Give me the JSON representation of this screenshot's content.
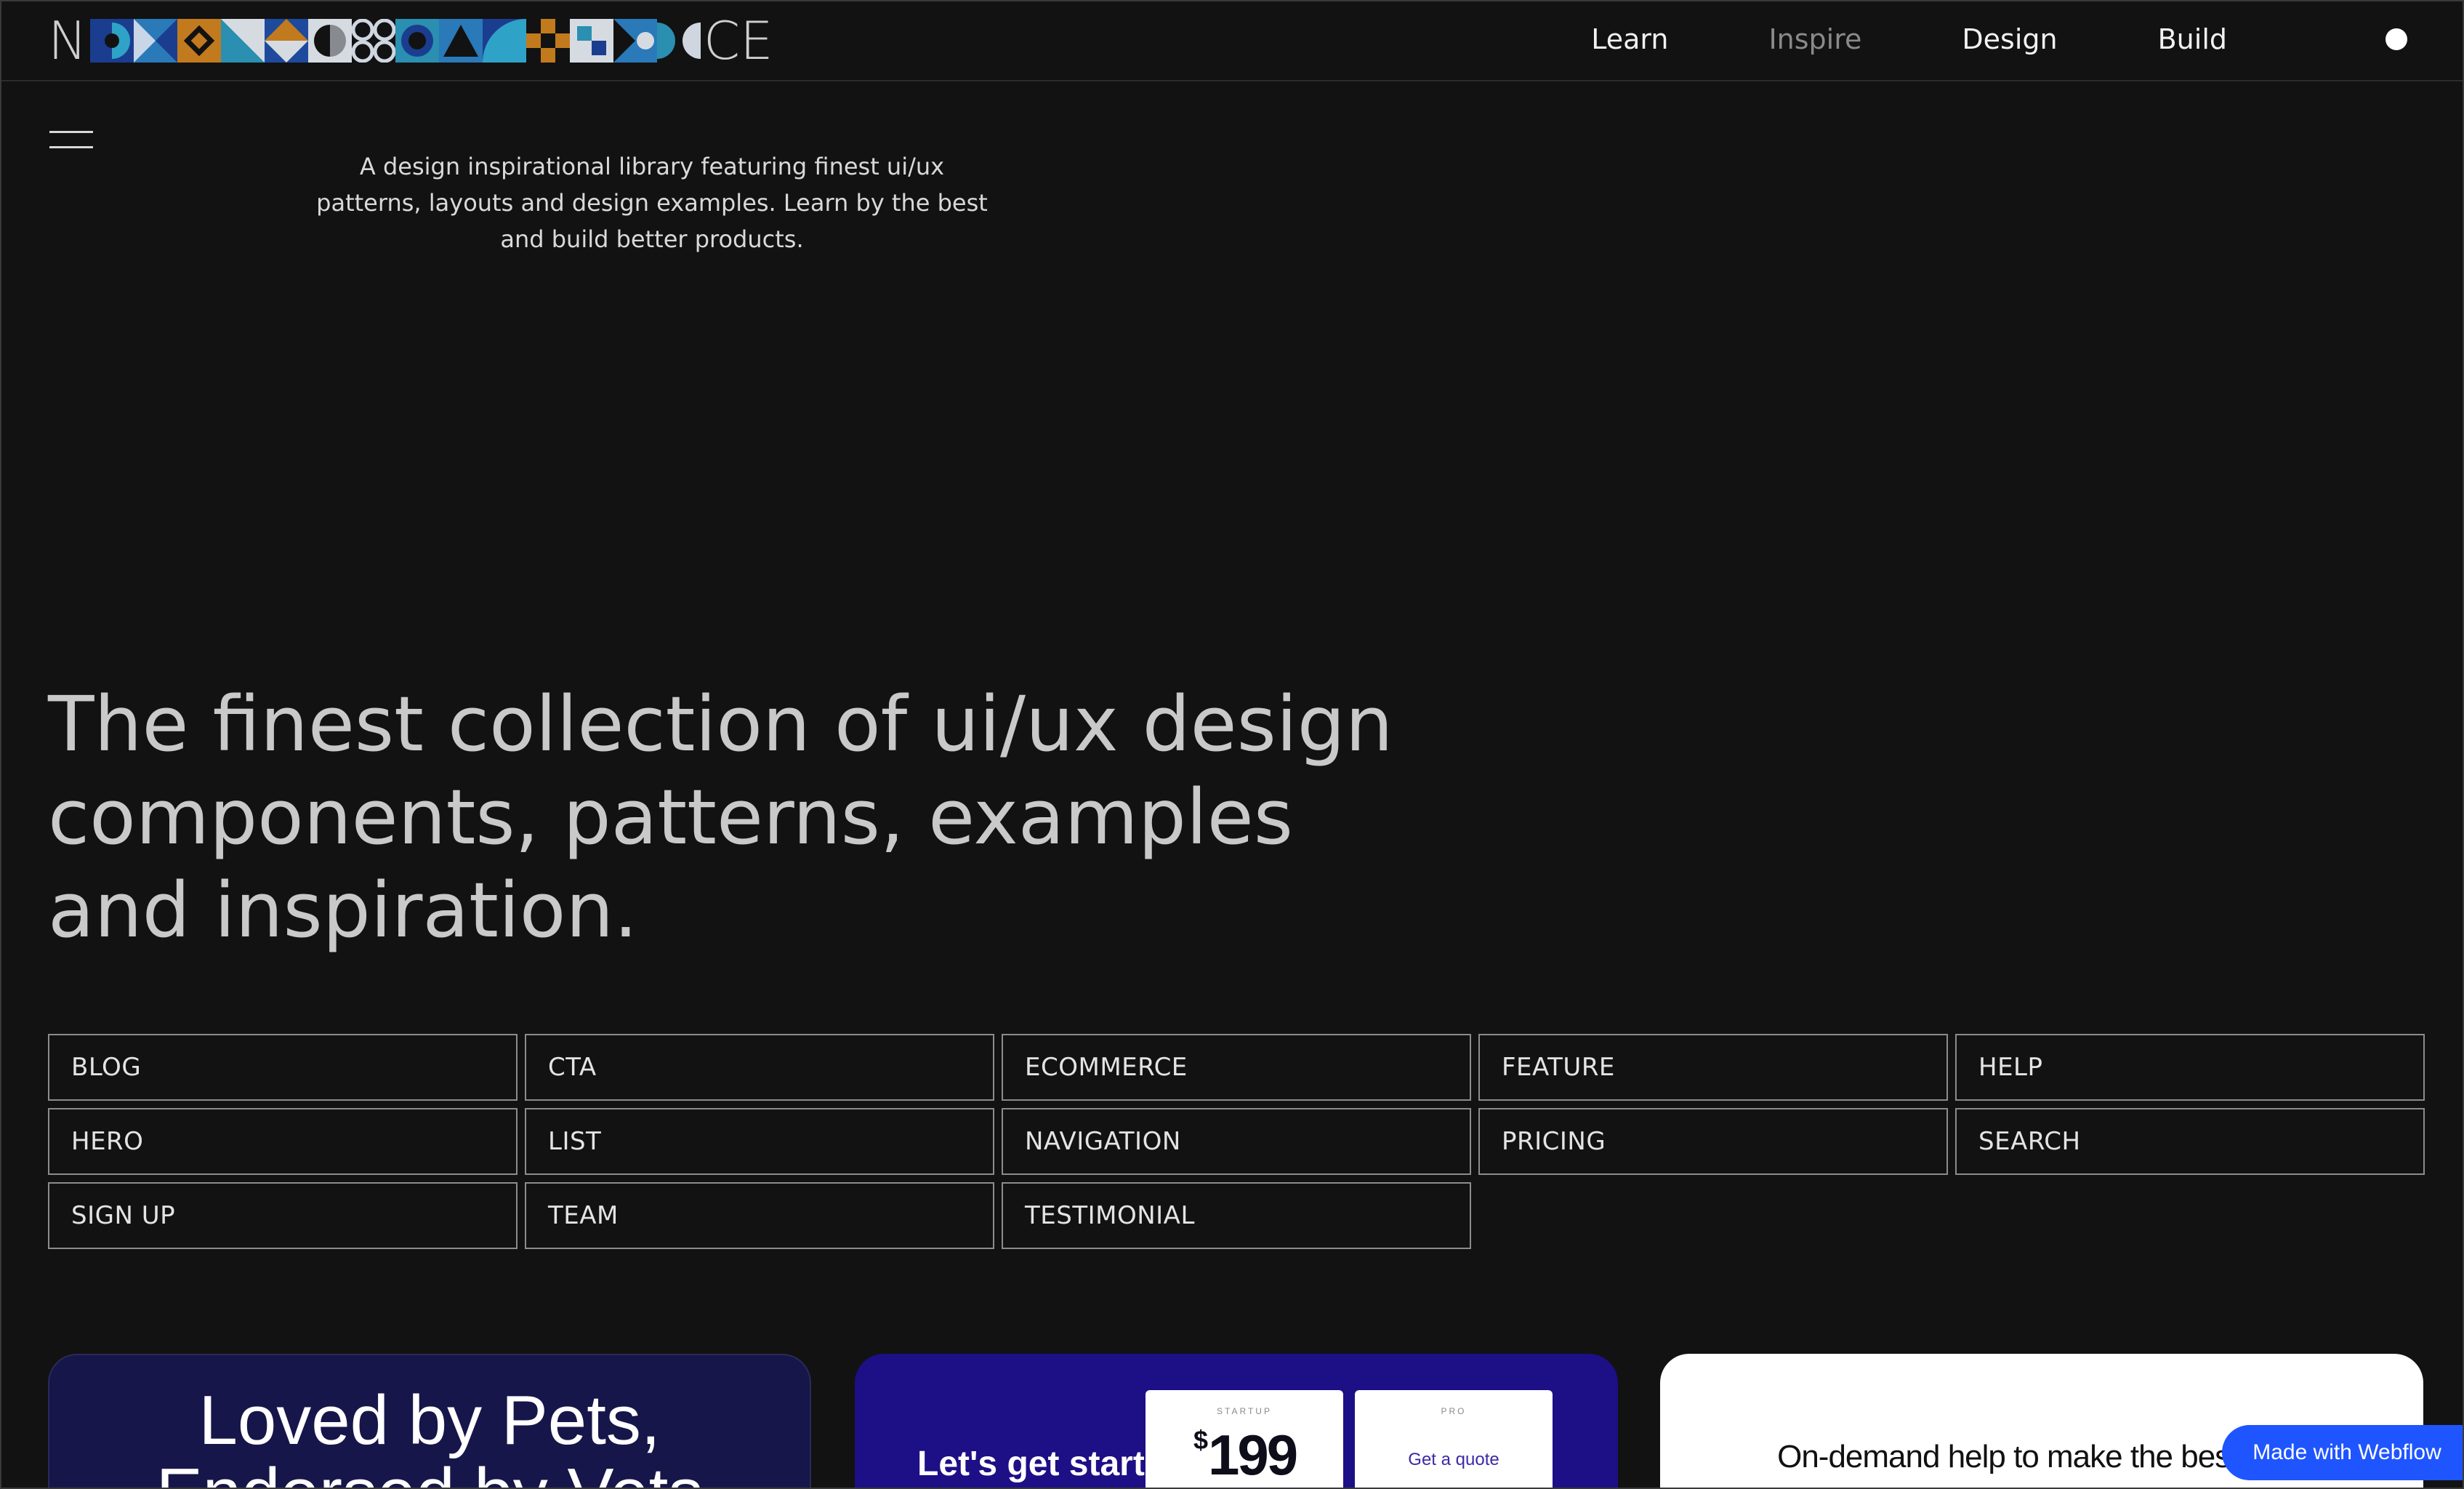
{
  "header": {
    "logo_prefix": "N",
    "logo_suffix": "CE",
    "nav": [
      {
        "label": "Learn"
      },
      {
        "label": "Inspire"
      },
      {
        "label": "Design"
      },
      {
        "label": "Build"
      }
    ]
  },
  "hero": {
    "tagline": "A design inspirational library featuring finest ui/ux patterns, layouts and design examples. Learn by the best and build better products.",
    "headline": "The finest collection of ui/ux design components, patterns, examples and inspiration."
  },
  "categories": [
    "BLOG",
    "CTA",
    "ECOMMERCE",
    "FEATURE",
    "HELP",
    "HERO",
    "LIST",
    "NAVIGATION",
    "PRICING",
    "SEARCH",
    "SIGN UP",
    "TEAM",
    "TESTIMONIAL"
  ],
  "cards": {
    "card1_title": "Loved by Pets, Endorsed by Vets",
    "card2_text": "Let's get started",
    "card2_plan1": "STARTUP",
    "card2_currency": "$",
    "card2_price": "199",
    "card2_plan2": "PRO",
    "card2_quote": "Get a quote",
    "card3_text": "On-demand help to make the best offer"
  },
  "badge": {
    "label": "Made with Webflow"
  },
  "colors": {
    "background": "#121212",
    "accent_blue": "#1f55ff",
    "card1_bg": "#17164a",
    "card2_bg": "#1d0f86"
  }
}
